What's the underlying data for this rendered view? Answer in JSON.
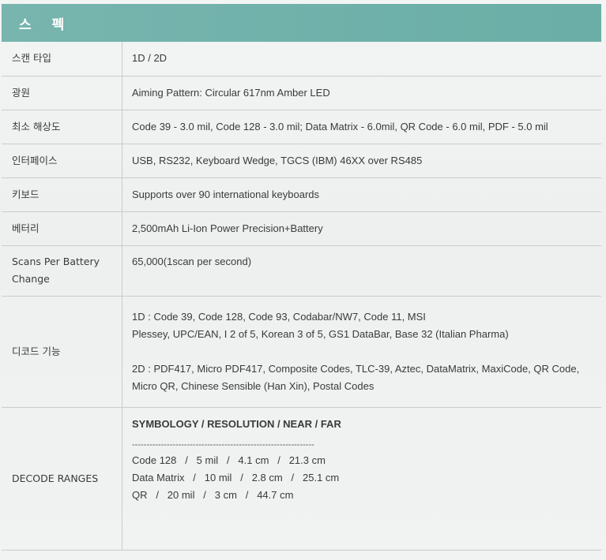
{
  "header": {
    "title": "스펙"
  },
  "rows": [
    {
      "label": "스캔 타입",
      "value": "1D / 2D"
    },
    {
      "label": "광원",
      "value": "Aiming Pattern: Circular 617nm Amber LED"
    },
    {
      "label": "최소 해상도",
      "value": "Code 39 - 3.0 mil, Code 128 - 3.0 mil; Data Matrix - 6.0mil, QR Code - 6.0 mil, PDF - 5.0 mil"
    },
    {
      "label": "인터페이스",
      "value": "USB, RS232, Keyboard Wedge, TGCS (IBM) 46XX over RS485"
    },
    {
      "label": "키보드",
      "value": "Supports over 90 international keyboards"
    },
    {
      "label": "베터리",
      "value": "2,500mAh Li-Ion Power Precision+Battery"
    },
    {
      "label_lines": [
        "Scans Per Battery",
        "Change"
      ],
      "value": "65,000(1scan per second)"
    }
  ],
  "decode": {
    "label": "디코드 기능",
    "lines_1d": [
      "1D : Code 39, Code 128, Code 93, Codabar/NW7, Code 11, MSI",
      "Plessey, UPC/EAN, I 2 of 5, Korean 3 of 5, GS1 DataBar, Base 32 (Italian Pharma)"
    ],
    "lines_2d": [
      "2D : PDF417, Micro PDF417, Composite Codes, TLC-39, Aztec, DataMatrix, MaxiCode, QR Code,",
      "Micro QR, Chinese Sensible (Han Xin), Postal Codes"
    ]
  },
  "ranges": {
    "label": "DECODE RANGES",
    "heading": "SYMBOLOGY / RESOLUTION / NEAR / FAR",
    "divider": "---------------------------------------------------------------",
    "entries": [
      "Code 128   /   5 mil   /   4.1 cm   /   21.3 cm",
      "Data Matrix   /   10 mil   /   2.8 cm   /   25.1 cm",
      "QR   /   20 mil   /   3 cm   /   44.7 cm"
    ]
  }
}
